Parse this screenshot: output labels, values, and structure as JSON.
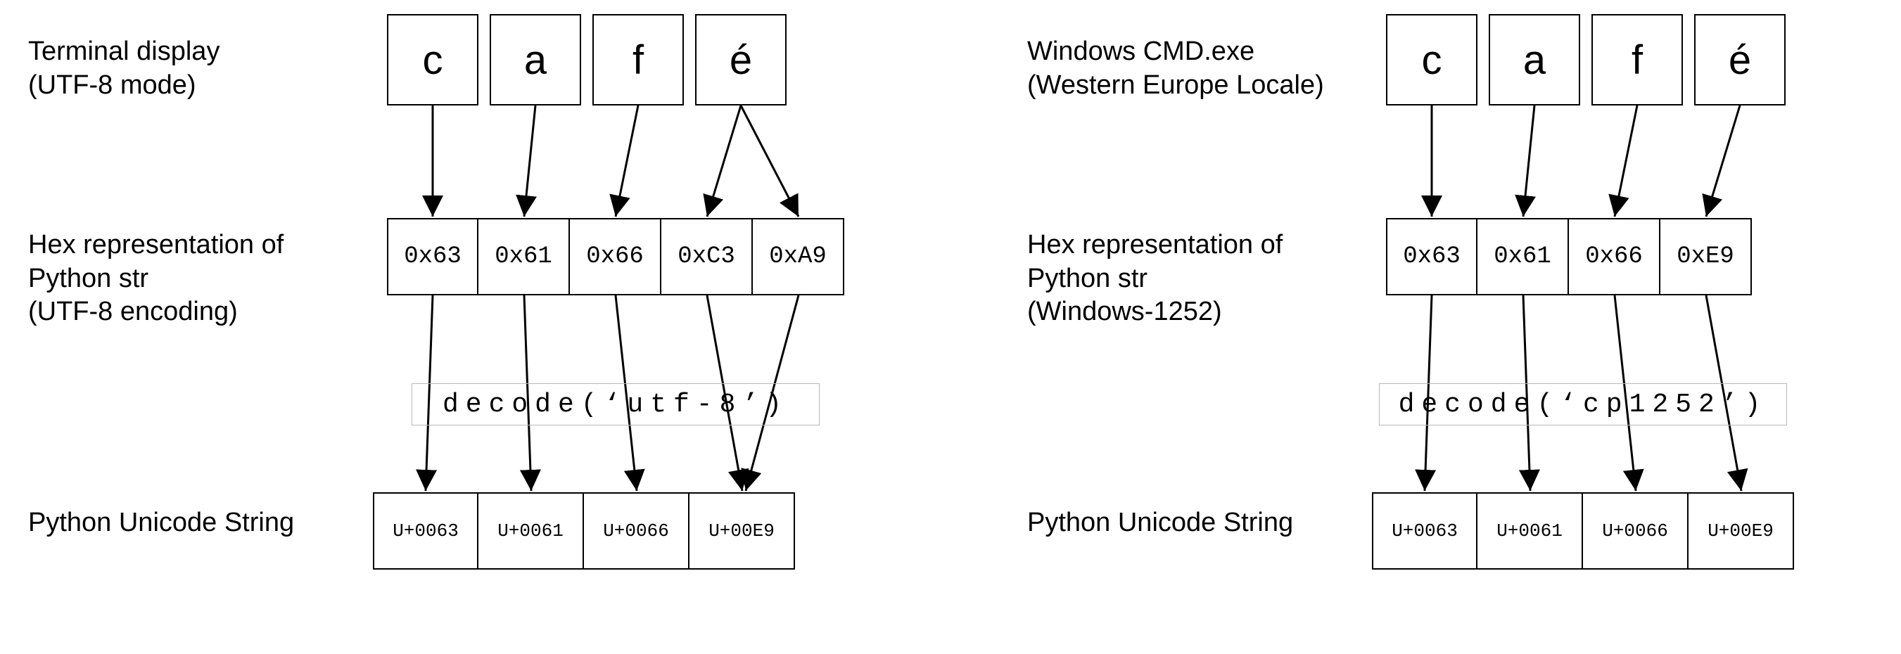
{
  "left": {
    "label_row1_a": "Terminal display",
    "label_row1_b": "(UTF-8 mode)",
    "label_row2_a": "Hex representation of",
    "label_row2_b": "Python str",
    "label_row2_c": "(UTF-8 encoding)",
    "label_row3": "Python Unicode String",
    "row1": [
      "c",
      "a",
      "f",
      "é"
    ],
    "row2": [
      "0x63",
      "0x61",
      "0x66",
      "0xC3",
      "0xA9"
    ],
    "row3": [
      "U+0063",
      "U+0061",
      "U+0066",
      "U+00E9"
    ],
    "decode": "decode(‘utf-8’)"
  },
  "right": {
    "label_row1_a": "Windows CMD.exe",
    "label_row1_b": "(Western Europe Locale)",
    "label_row2_a": "Hex representation of",
    "label_row2_b": "Python str",
    "label_row2_c": "(Windows-1252)",
    "label_row3": "Python Unicode String",
    "row1": [
      "c",
      "a",
      "f",
      "é"
    ],
    "row2": [
      "0x63",
      "0x61",
      "0x66",
      "0xE9"
    ],
    "row3": [
      "U+0063",
      "U+0061",
      "U+0066",
      "U+00E9"
    ],
    "decode": "decode(‘cp1252’)"
  }
}
